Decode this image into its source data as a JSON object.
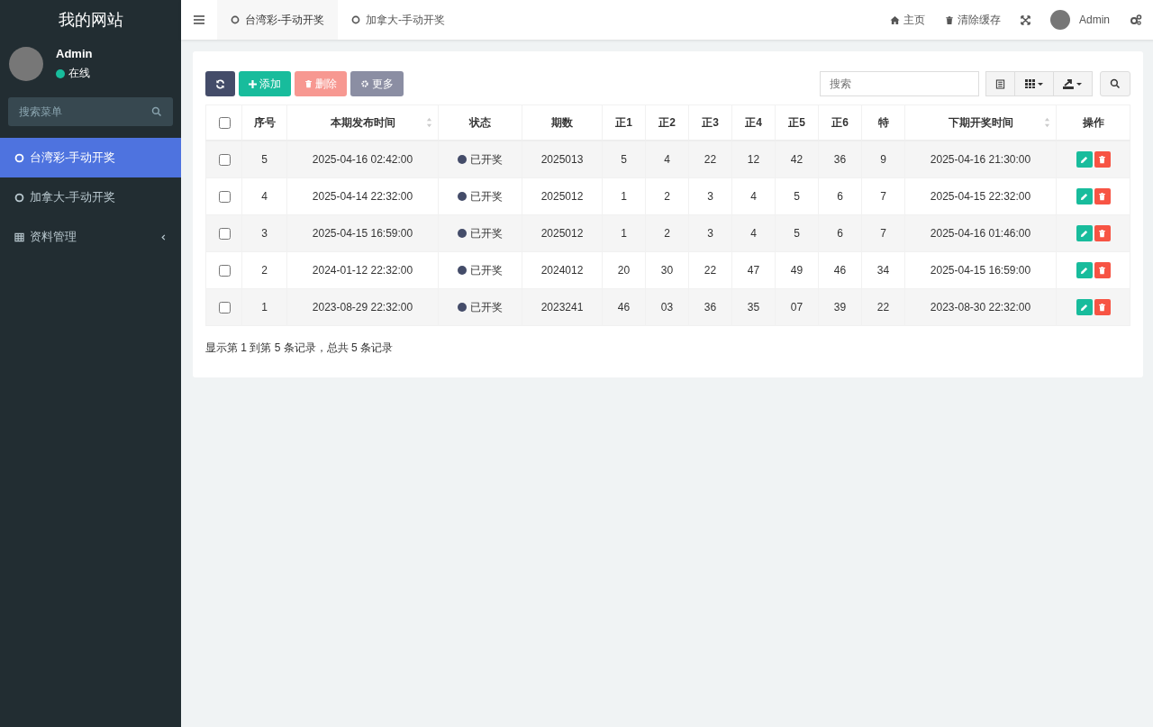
{
  "site_title": "我的网站",
  "user": {
    "name": "Admin",
    "status": "在线"
  },
  "sidebar": {
    "search_placeholder": "搜索菜单",
    "items": [
      {
        "kind": "page",
        "label": "台湾彩-手动开奖",
        "selected": true
      },
      {
        "kind": "page",
        "label": "加拿大-手动开奖",
        "selected": false
      },
      {
        "kind": "folder",
        "label": "资料管理",
        "selected": false,
        "expanded": false
      }
    ]
  },
  "tabs": [
    {
      "label": "台湾彩-手动开奖",
      "selected": true
    },
    {
      "label": "加拿大-手动开奖",
      "selected": false
    }
  ],
  "top_right": {
    "home": "主页",
    "clear_cache": "清除缓存",
    "user": "Admin"
  },
  "toolbar": {
    "add": "添加",
    "delete": "删除",
    "more": "更多",
    "search_placeholder": "搜索"
  },
  "table": {
    "select_all_checked": false,
    "columns": [
      {
        "label": "序号",
        "sortable": false
      },
      {
        "label": "本期发布时间",
        "sortable": true
      },
      {
        "label": "状态",
        "sortable": false
      },
      {
        "label": "期数",
        "sortable": false
      },
      {
        "label": "正1",
        "sortable": false
      },
      {
        "label": "正2",
        "sortable": false
      },
      {
        "label": "正3",
        "sortable": false
      },
      {
        "label": "正4",
        "sortable": false
      },
      {
        "label": "正5",
        "sortable": false
      },
      {
        "label": "正6",
        "sortable": false
      },
      {
        "label": "特",
        "sortable": false
      },
      {
        "label": "下期开奖时间",
        "sortable": true
      },
      {
        "label": "操作",
        "sortable": false
      }
    ],
    "rows": [
      {
        "checked": false,
        "cells": [
          "5",
          "2025-04-16 02:42:00",
          "已开奖",
          "2025013",
          "5",
          "4",
          "22",
          "12",
          "42",
          "36",
          "9",
          "2025-04-16 21:30:00"
        ]
      },
      {
        "checked": false,
        "cells": [
          "4",
          "2025-04-14 22:32:00",
          "已开奖",
          "2025012",
          "1",
          "2",
          "3",
          "4",
          "5",
          "6",
          "7",
          "2025-04-15 22:32:00"
        ]
      },
      {
        "checked": false,
        "cells": [
          "3",
          "2025-04-15 16:59:00",
          "已开奖",
          "2025012",
          "1",
          "2",
          "3",
          "4",
          "5",
          "6",
          "7",
          "2025-04-16 01:46:00"
        ]
      },
      {
        "checked": false,
        "cells": [
          "2",
          "2024-01-12 22:32:00",
          "已开奖",
          "2024012",
          "20",
          "30",
          "22",
          "47",
          "49",
          "46",
          "34",
          "2025-04-15 16:59:00"
        ]
      },
      {
        "checked": false,
        "cells": [
          "1",
          "2023-08-29 22:32:00",
          "已开奖",
          "2023241",
          "46",
          "03",
          "36",
          "35",
          "07",
          "39",
          "22",
          "2023-08-30 22:32:00"
        ]
      }
    ],
    "footer": "显示第 1 到第 5 条记录，总共 5 条记录"
  }
}
